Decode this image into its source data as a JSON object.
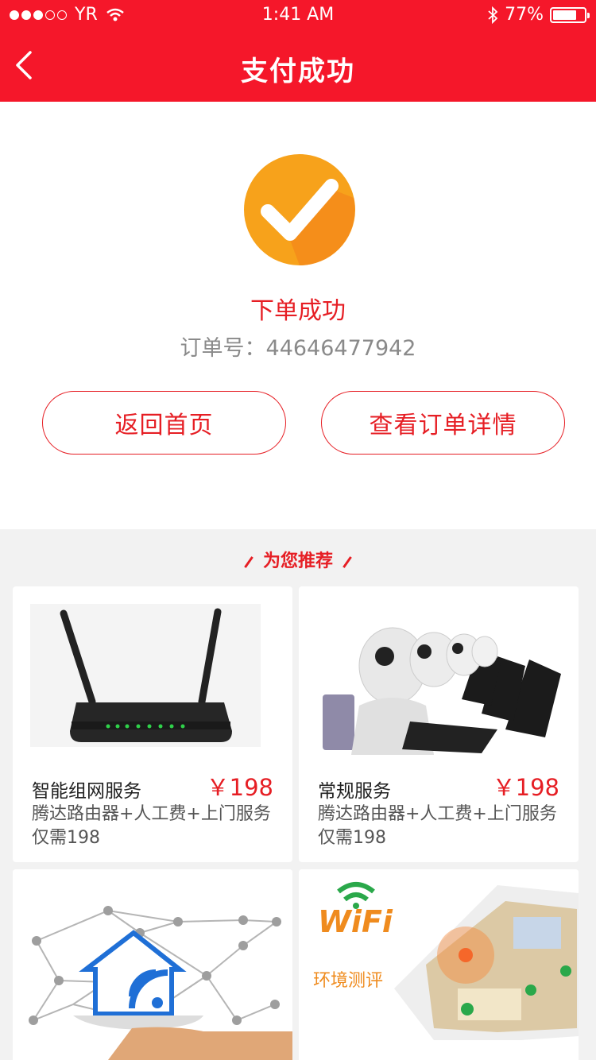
{
  "status_bar": {
    "carrier": "YR",
    "time": "1:41 AM",
    "battery_percent": "77%",
    "battery_level": 0.77
  },
  "nav": {
    "title": "支付成功"
  },
  "success": {
    "title": "下单成功",
    "order_label": "订单号：",
    "order_number": "44646477942",
    "home_button": "返回首页",
    "detail_button": "查看订单详情"
  },
  "recommend": {
    "header": "为您推荐",
    "items": [
      {
        "name": "智能组网服务",
        "price": "￥198",
        "desc": "腾达路由器+人工费+上门服务仅需198",
        "image": "router-image"
      },
      {
        "name": "常规服务",
        "price": "￥198",
        "desc": "腾达路由器+人工费+上门服务仅需198",
        "image": "customer-service-image"
      },
      {
        "image": "smart-home-image"
      },
      {
        "image": "wifi-environment-image",
        "caption": "环境测评",
        "wifi_text": "WiFi"
      }
    ]
  },
  "colors": {
    "brand_red": "#f5172a",
    "accent_red": "#e61e24",
    "success_orange": "#f7a21b"
  }
}
